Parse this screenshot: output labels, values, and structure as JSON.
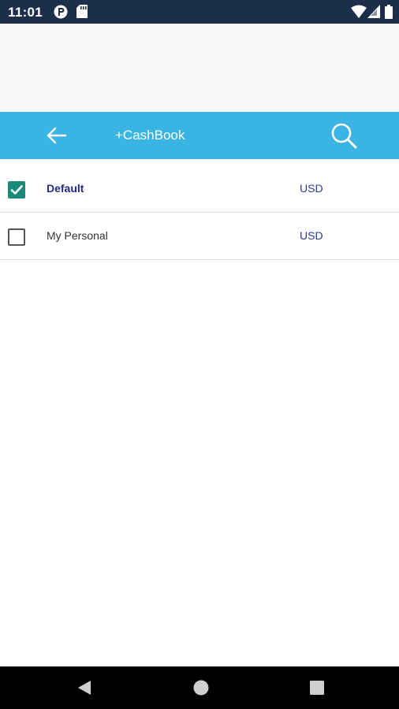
{
  "status_bar": {
    "time": "11:01",
    "icons": [
      "pocket-app-icon",
      "sd-card-icon",
      "wifi-icon",
      "signal-icon",
      "battery-icon"
    ]
  },
  "toolbar": {
    "title": "+CashBook",
    "back_icon": "arrow-left-icon",
    "search_icon": "search-icon",
    "background_color": "#39b4e3"
  },
  "accounts": [
    {
      "name": "Default",
      "currency": "USD",
      "checked": true
    },
    {
      "name": "My Personal",
      "currency": "USD",
      "checked": false
    }
  ],
  "nav_bar": {
    "buttons": [
      "back-triangle-icon",
      "home-circle-icon",
      "recents-square-icon"
    ]
  },
  "colors": {
    "checkbox_checked": "#1a8a78",
    "selected_text": "#1f2a8c",
    "status_bar": "#1c2f4a"
  }
}
